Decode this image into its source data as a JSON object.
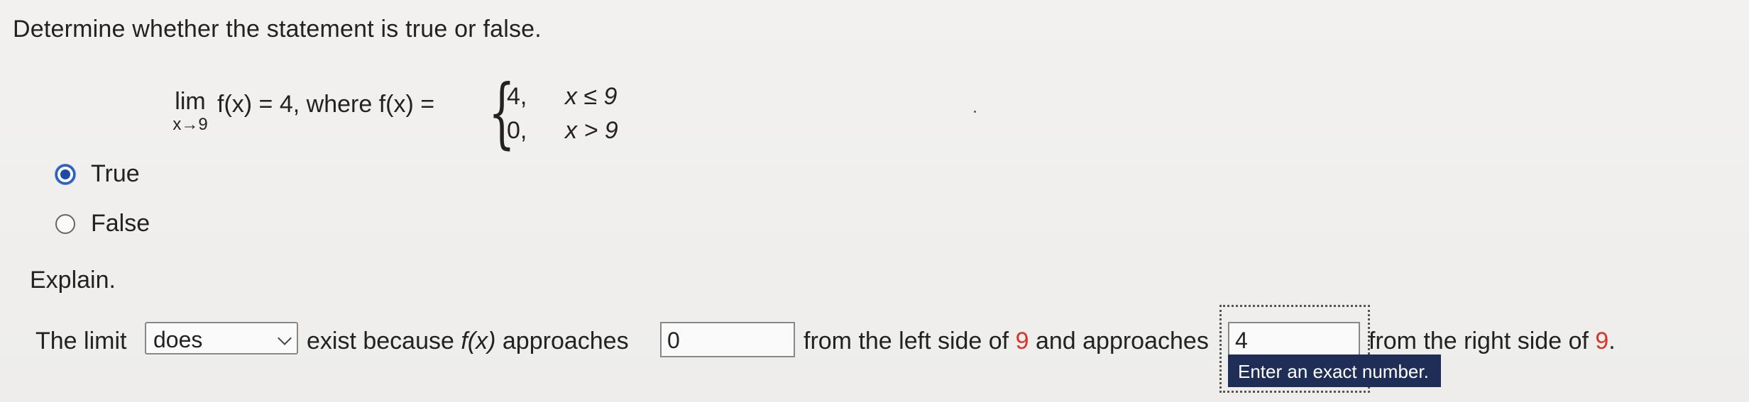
{
  "question": {
    "title": "Determine whether the statement is true or false."
  },
  "statement": {
    "lim_word": "lim",
    "lim_sub": "x→9",
    "main_text": "f(x) = 4, where f(x) =",
    "pieces": [
      {
        "value": "4,",
        "condition": "x ≤ 9"
      },
      {
        "value": "0,",
        "condition": "x > 9"
      }
    ]
  },
  "options": [
    {
      "label": "True",
      "selected": true
    },
    {
      "label": "False",
      "selected": false
    }
  ],
  "explain": {
    "label": "Explain.",
    "prefix": "The limit",
    "select_value": "does",
    "middle1_a": "exist because ",
    "middle1_fx": "f(x)",
    "middle1_b": " approaches",
    "left_input_value": "0",
    "middle2_a": "from the left side of ",
    "middle2_num": "9",
    "middle2_b": " and approaches",
    "right_input_value": "4",
    "suffix_a": "from the right side of ",
    "suffix_num": "9",
    "suffix_b": ".",
    "tooltip": "Enter an exact number."
  },
  "colors": {
    "accent_radio": "#1f4aa6",
    "highlight_number": "#d6362a",
    "tooltip_bg": "#1f2e57"
  },
  "icons": {
    "dropdown": "chevron-down-icon"
  }
}
